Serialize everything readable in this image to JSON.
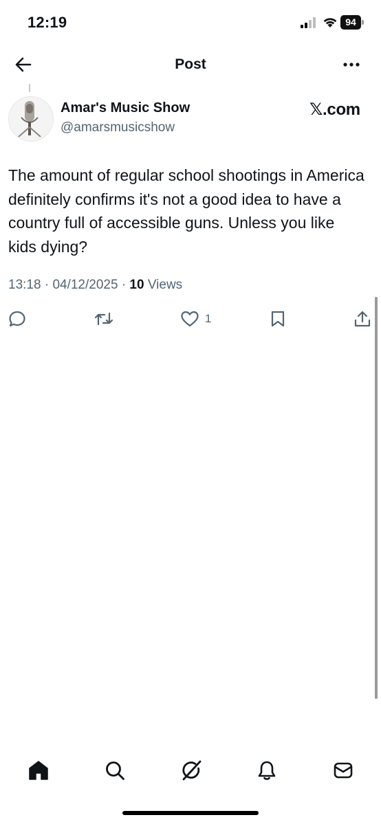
{
  "status_bar": {
    "time": "12:19",
    "battery": "94"
  },
  "header": {
    "title": "Post"
  },
  "author": {
    "display_name": "Amar's Music Show",
    "handle": "@amarsmusicshow",
    "source": "𝕏.com"
  },
  "post": {
    "text": "The amount of regular school shootings in America definitely confirms it's not a good idea to have a country full of accessible guns. Unless you like kids dying?",
    "time": "13:18",
    "date": "04/12/2025",
    "views_count": "10",
    "views_label": "Views",
    "separator": "·"
  },
  "actions": {
    "like_count": "1",
    "icons": [
      "reply-icon",
      "retweet-icon",
      "like-icon",
      "bookmark-icon",
      "share-icon"
    ]
  },
  "bottom_nav": {
    "icons": [
      "home-icon",
      "search-icon",
      "grok-icon",
      "notifications-icon",
      "messages-icon"
    ]
  },
  "colors": {
    "text": "#0f1419",
    "secondary": "#536471",
    "background": "#ffffff"
  }
}
